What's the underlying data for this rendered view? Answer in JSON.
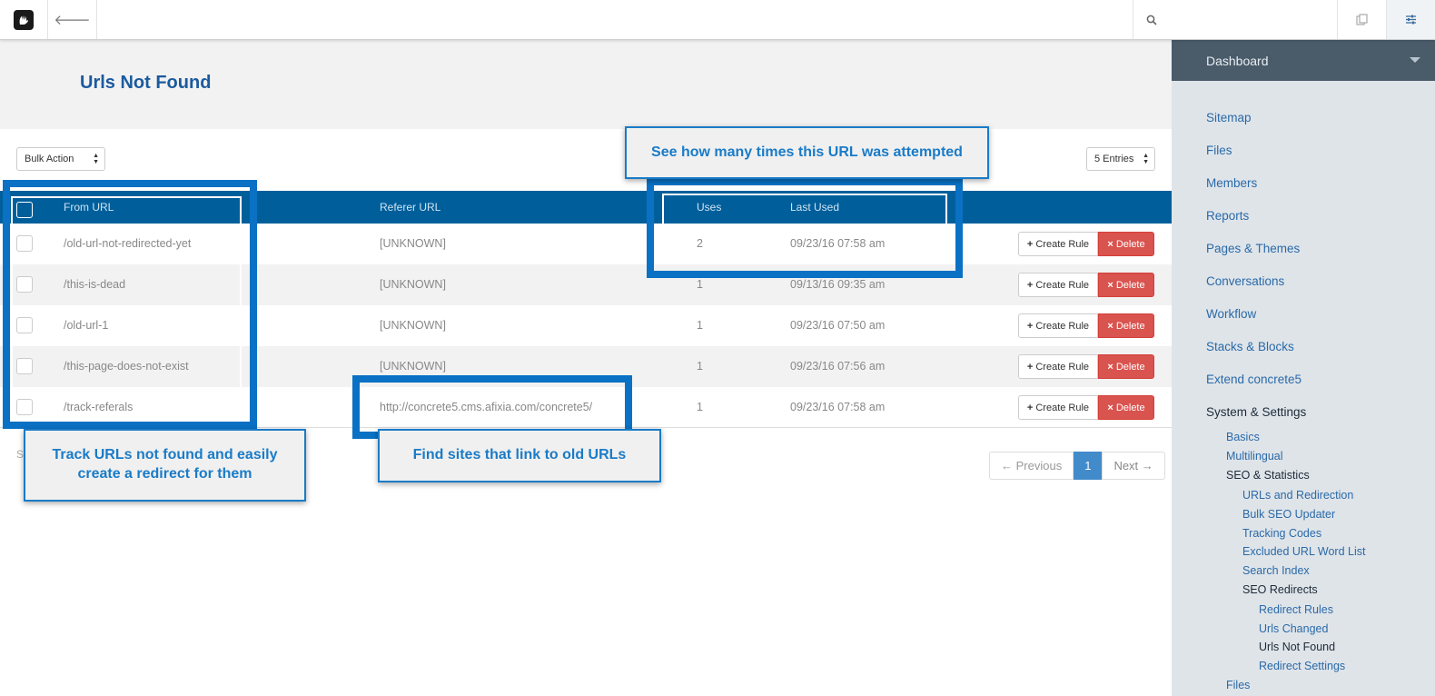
{
  "toolbar": {
    "logo": "concrete5-logo",
    "back_icon": "arrow-left-icon",
    "search_icon": "search-icon",
    "multi_icon": "copy-icon",
    "settings_icon": "sliders-icon"
  },
  "page": {
    "title": "Urls Not Found"
  },
  "controls": {
    "bulk_action": "Bulk Action",
    "entries": "5 Entries"
  },
  "table": {
    "headers": {
      "from_url": "From URL",
      "referer_url": "Referer URL",
      "uses": "Uses",
      "last_used": "Last Used"
    },
    "rows": [
      {
        "from": "/old-url-not-redirected-yet",
        "referer": "[UNKNOWN]",
        "uses": "2",
        "last_used": "09/23/16 07:58 am"
      },
      {
        "from": "/this-is-dead",
        "referer": "[UNKNOWN]",
        "uses": "1",
        "last_used": "09/13/16 09:35 am"
      },
      {
        "from": "/old-url-1",
        "referer": "[UNKNOWN]",
        "uses": "1",
        "last_used": "09/23/16 07:50 am"
      },
      {
        "from": "/this-page-does-not-exist",
        "referer": "[UNKNOWN]",
        "uses": "1",
        "last_used": "09/23/16 07:56 am"
      },
      {
        "from": "/track-referals",
        "referer": "http://concrete5.cms.afixia.com/concrete5/",
        "uses": "1",
        "last_used": "09/23/16 07:58 am"
      }
    ],
    "create_rule_label": "Create Rule",
    "delete_label": "Delete",
    "stray_text": "S"
  },
  "pagination": {
    "previous": "← Previous",
    "current": "1",
    "next": "Next →"
  },
  "callouts": {
    "uses": "See how many times this URL was attempted",
    "track": "Track URLs not found and easily create a redirect for them",
    "referer": "Find sites that link to old URLs"
  },
  "sidebar": {
    "header": "Dashboard",
    "items": {
      "sitemap": "Sitemap",
      "files": "Files",
      "members": "Members",
      "reports": "Reports",
      "pages_themes": "Pages & Themes",
      "conversations": "Conversations",
      "workflow": "Workflow",
      "stacks_blocks": "Stacks & Blocks",
      "extend": "Extend concrete5",
      "system_settings": "System & Settings",
      "basics": "Basics",
      "multilingual": "Multilingual",
      "seo_statistics": "SEO & Statistics",
      "urls_redirection": "URLs and Redirection",
      "bulk_seo": "Bulk SEO Updater",
      "tracking_codes": "Tracking Codes",
      "excluded_words": "Excluded URL Word List",
      "search_index": "Search Index",
      "seo_redirects": "SEO Redirects",
      "redirect_rules": "Redirect Rules",
      "urls_changed": "Urls Changed",
      "urls_not_found": "Urls Not Found",
      "redirect_settings": "Redirect Settings",
      "files2": "Files"
    }
  }
}
